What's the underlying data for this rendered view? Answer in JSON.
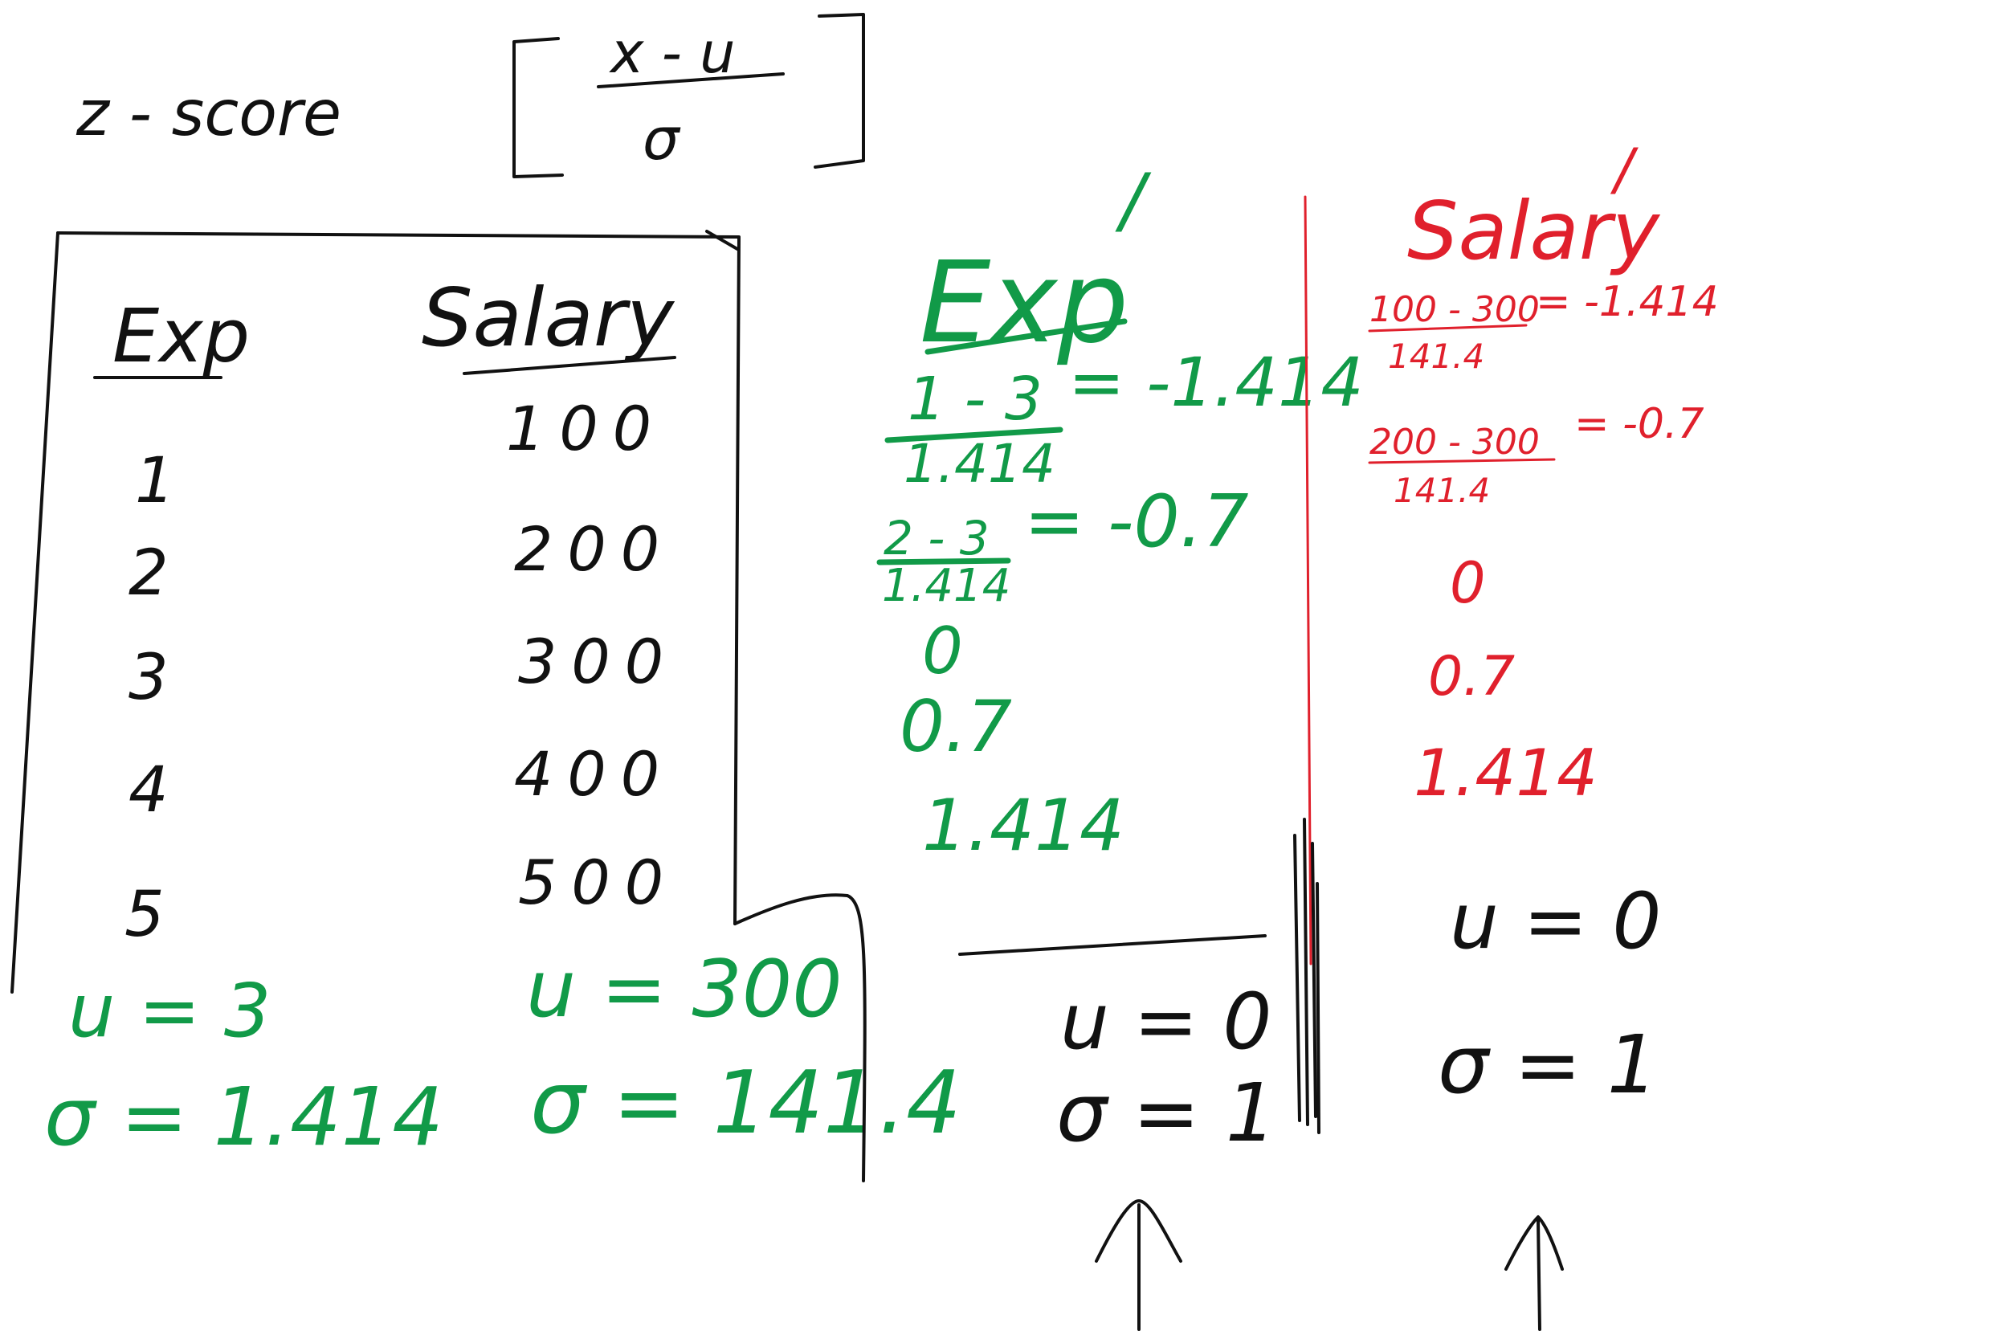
{
  "formula": {
    "prefix": "z - score",
    "numerator": "x - u",
    "denominator": "σ"
  },
  "table": {
    "exp_header": "Exp",
    "salary_header": "Salary",
    "exp_values": [
      "1",
      "2",
      "3",
      "4",
      "5"
    ],
    "salary_values": [
      "100",
      "200",
      "300",
      "400",
      "500"
    ],
    "exp_mean": "u = 3",
    "exp_std": "σ = 1.414",
    "salary_mean": "u = 300",
    "salary_std": "σ = 141.4"
  },
  "exp_scaled": {
    "title": "Exp",
    "prime_mark": "/",
    "row1_num": "1 - 3",
    "row1_den": "1.414",
    "row1_result": "= -1.414",
    "row2_num": "2 - 3",
    "row2_den": "1.414",
    "row2_result": "= -0.7",
    "row3": "0",
    "row4": "0.7",
    "row5": "1.414",
    "mean": "u = 0",
    "std": "σ = 1"
  },
  "salary_scaled": {
    "title": "Salary",
    "prime_mark": "/",
    "row1_num": "100 - 300",
    "row1_den": "141.4",
    "row1_result": "= -1.414",
    "row2_num": "200 - 300",
    "row2_den": "141.4",
    "row2_result": "= -0.7",
    "row3": "0",
    "row4": "0.7",
    "row5": "1.414",
    "mean": "u = 0",
    "std": "σ = 1"
  },
  "colors": {
    "black_ink": "#111111",
    "green_ink": "#119a48",
    "red_ink": "#e0202c",
    "background": "#ffffff"
  }
}
